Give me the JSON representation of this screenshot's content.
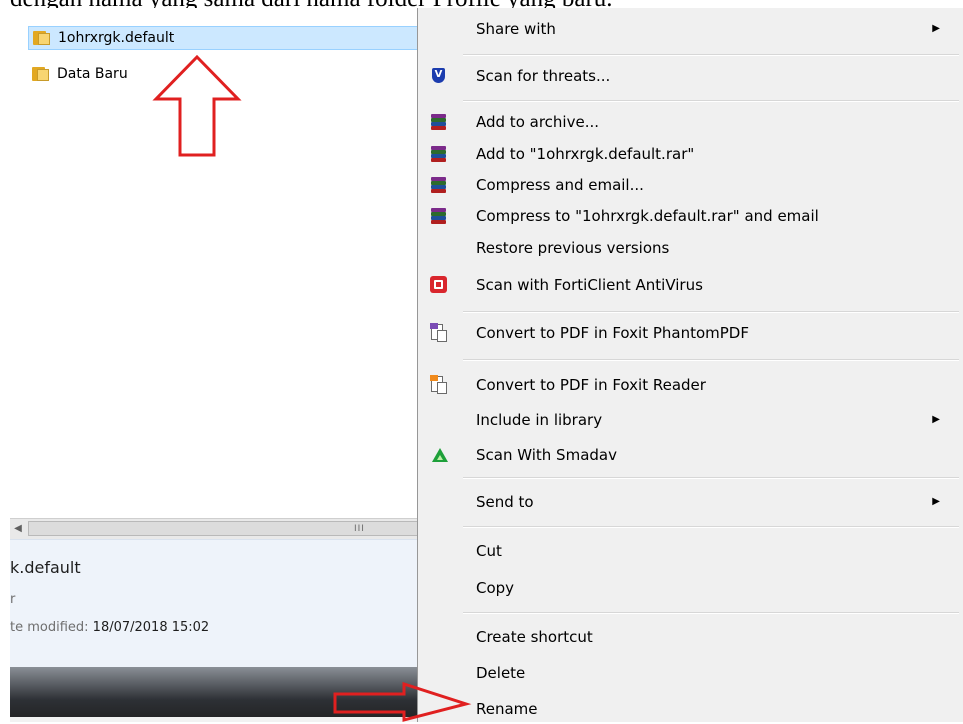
{
  "background_text": "dengan nama yang sama dari nama folder Profile yang baru.",
  "explorer": {
    "files": [
      {
        "name": "1ohrxrgk.default",
        "selected": true
      },
      {
        "name": "Data Baru",
        "selected": false
      }
    ],
    "scroll_grip": "III",
    "details": {
      "name": "k.default",
      "type": "r",
      "modified_label": "te modified:",
      "modified_value": "18/07/2018 15:02"
    }
  },
  "context_menu": {
    "share_with": "Share with",
    "scan_threats": "Scan for threats...",
    "add_archive": "Add to archive...",
    "add_rar": "Add to \"1ohrxrgk.default.rar\"",
    "compress_email": "Compress and email...",
    "compress_rar_email": "Compress to \"1ohrxrgk.default.rar\" and email",
    "restore_versions": "Restore previous versions",
    "scan_forticlient": "Scan with FortiClient AntiVirus",
    "convert_phantom": "Convert to PDF in Foxit PhantomPDF",
    "convert_reader": "Convert to PDF in Foxit Reader",
    "include_library": "Include in library",
    "scan_smadav": "Scan With Smadav",
    "send_to": "Send to",
    "cut": "Cut",
    "copy": "Copy",
    "create_shortcut": "Create shortcut",
    "delete": "Delete",
    "rename": "Rename"
  },
  "annotation_color": "#e02020",
  "icons": {
    "folder": "folder-icon",
    "antivirus": "antivirus-shield-icon",
    "winrar": "winrar-books-icon",
    "forticlient": "forticlient-icon",
    "foxit": "foxit-pdf-icon",
    "smadav": "smadav-icon",
    "submenu": "chevron-right-icon"
  }
}
